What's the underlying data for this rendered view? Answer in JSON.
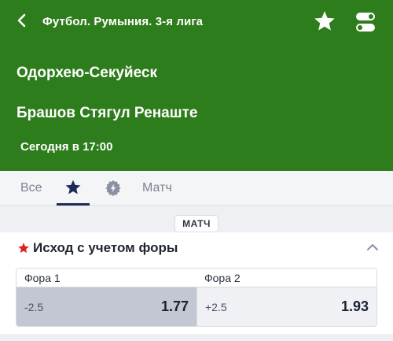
{
  "header": {
    "league": "Футбол. Румыния. 3-я лига",
    "team_home": "Одорхею-Секуйеск",
    "team_away": "Брашов Стягул Ренаште",
    "start_time": "Сегодня в 17:00",
    "colors": {
      "background": "#2e7d1c",
      "text": "#ffffff"
    },
    "icons": [
      "back-arrow-icon",
      "favorite-star-icon",
      "settings-toggle-icon"
    ]
  },
  "tabs": {
    "all_label": "Все",
    "favorites_icon": "star-icon",
    "live_icon": "lightning-badge-icon",
    "match_label": "Матч",
    "active": "favorites"
  },
  "section": {
    "label": "МАТЧ"
  },
  "market": {
    "title": "Исход с учетом форы",
    "icon": "red-star-icon",
    "collapse_icon": "chevron-up-icon",
    "columns": [
      "Фора 1",
      "Фора 2"
    ],
    "outcomes": [
      {
        "handicap": "-2.5",
        "odds": "1.77",
        "selected": true
      },
      {
        "handicap": "+2.5",
        "odds": "1.93",
        "selected": false
      }
    ]
  }
}
